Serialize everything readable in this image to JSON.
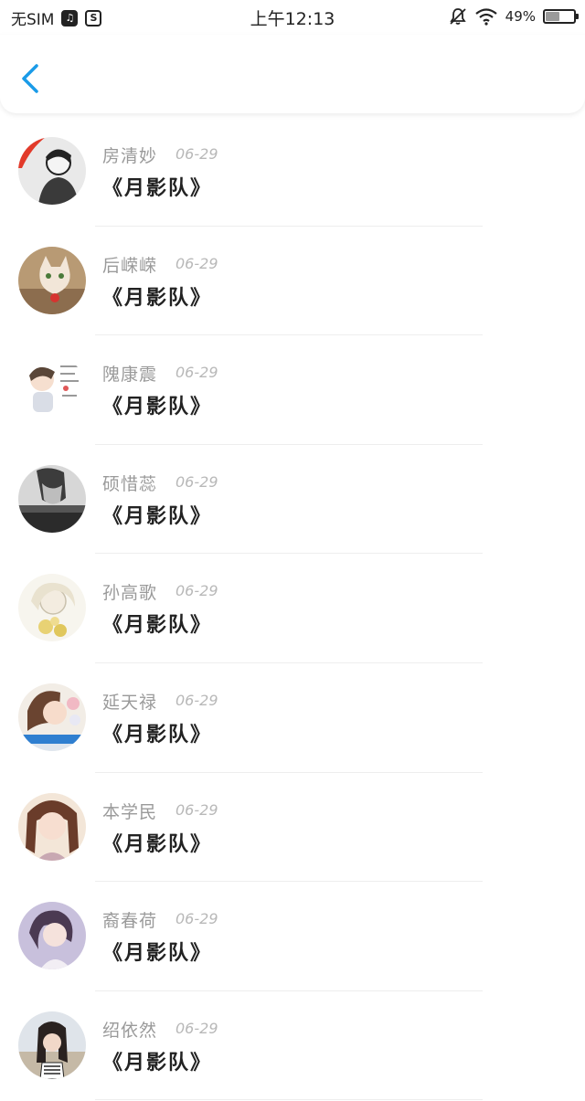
{
  "status_bar": {
    "sim": "无SIM",
    "time": "上午12:13",
    "battery_percent": "49%",
    "battery_level": 0.49
  },
  "header": {
    "back_icon": "chevron-left-icon",
    "accent_color": "#1a9be8"
  },
  "list": {
    "items": [
      {
        "name": "房清妙",
        "date": "06-29",
        "title": "《月影队》",
        "avatar": "bw-boy"
      },
      {
        "name": "后嵘嵘",
        "date": "06-29",
        "title": "《月影队》",
        "avatar": "cat"
      },
      {
        "name": "隗康震",
        "date": "06-29",
        "title": "《月影队》",
        "avatar": "cartoon"
      },
      {
        "name": "硕惜蕊",
        "date": "06-29",
        "title": "《月影队》",
        "avatar": "bw-man"
      },
      {
        "name": "孙高歌",
        "date": "06-29",
        "title": "《月影队》",
        "avatar": "sketch"
      },
      {
        "name": "延天禄",
        "date": "06-29",
        "title": "《月影队》",
        "avatar": "girl-flowers"
      },
      {
        "name": "本学民",
        "date": "06-29",
        "title": "《月影队》",
        "avatar": "girl-light"
      },
      {
        "name": "裔春荷",
        "date": "06-29",
        "title": "《月影队》",
        "avatar": "girl-purple"
      },
      {
        "name": "绍依然",
        "date": "06-29",
        "title": "《月影队》",
        "avatar": "girl-beach"
      }
    ]
  }
}
